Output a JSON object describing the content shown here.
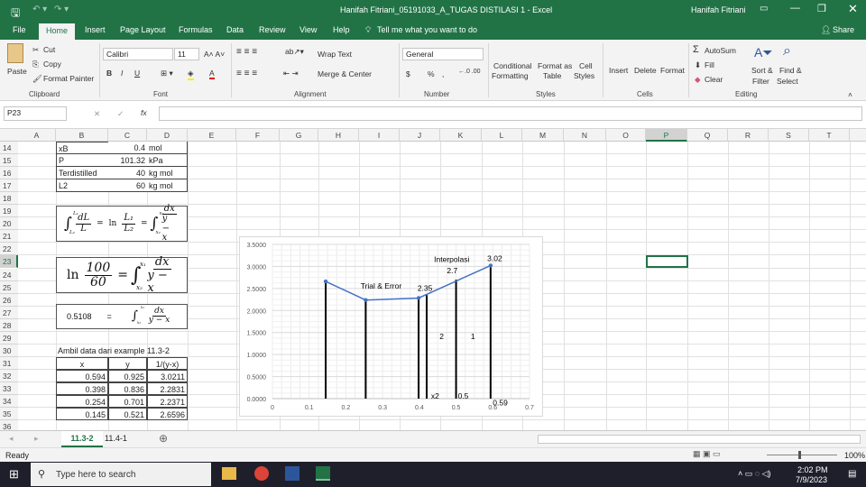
{
  "title": {
    "filename": "Hanifah Fitriani_05191033_A_TUGAS DISTILASI 1  -  Excel",
    "user": "Hanifah Fitriani"
  },
  "menu": {
    "tabs": [
      "File",
      "Home",
      "Insert",
      "Page Layout",
      "Formulas",
      "Data",
      "Review",
      "View",
      "Help"
    ],
    "tell_me": "Tell me what you want to do",
    "share": "Share"
  },
  "ribbon": {
    "clipboard": {
      "paste": "Paste",
      "cut": "Cut",
      "copy": "Copy",
      "format_painter": "Format Painter",
      "label": "Clipboard"
    },
    "font": {
      "name": "Calibri",
      "size": "11",
      "label": "Font",
      "bold": "B",
      "italic": "I",
      "underline": "U"
    },
    "alignment": {
      "wrap": "Wrap Text",
      "merge": "Merge & Center",
      "label": "Alignment"
    },
    "number": {
      "format": "General",
      "currency": "$",
      "percent": "%",
      "comma": ",",
      "label": "Number"
    },
    "styles": {
      "conditional": "Conditional",
      "conditional2": "Formatting",
      "format_table": "Format as",
      "format_table2": "Table",
      "cell_styles": "Cell",
      "cell_styles2": "Styles",
      "label": "Styles"
    },
    "cells": {
      "insert": "Insert",
      "delete": "Delete",
      "format": "Format",
      "label": "Cells"
    },
    "editing": {
      "autosum": "AutoSum",
      "fill": "Fill",
      "clear": "Clear",
      "sort": "Sort &",
      "sort2": "Filter",
      "find": "Find &",
      "find2": "Select",
      "label": "Editing"
    }
  },
  "formula_bar": {
    "name_box": "P23",
    "fx": "fx",
    "value": ""
  },
  "columns": [
    "A",
    "B",
    "C",
    "D",
    "E",
    "F",
    "G",
    "H",
    "I",
    "J",
    "K",
    "L",
    "M",
    "N",
    "O",
    "P",
    "Q",
    "R",
    "S",
    "T"
  ],
  "rows": [
    "14",
    "15",
    "16",
    "17",
    "18",
    "19",
    "20",
    "21",
    "22",
    "23",
    "24",
    "25",
    "26",
    "27",
    "28",
    "29",
    "30",
    "31",
    "32",
    "33",
    "34",
    "35",
    "36"
  ],
  "selected_cell": "P23",
  "params": [
    [
      "xB",
      "0.4",
      "mol"
    ],
    [
      "P",
      "101.32",
      "kPa"
    ],
    [
      "Terdistilled",
      "40",
      "kg mol"
    ],
    [
      "L2",
      "60",
      "kg mol"
    ]
  ],
  "equations": {
    "eq1": {
      "int_lower": "L₂",
      "int_upper": "L₁",
      "frac1_num": "dL",
      "frac1_den": "L",
      "ln": "ln",
      "frac2_num": "L₁",
      "frac2_den": "L₂",
      "int2_lower": "x₂",
      "int2_upper": "x₁",
      "frac3_num": "dx",
      "frac3_den": "y − x",
      "eq": "="
    },
    "eq2": {
      "ln": "ln",
      "num": "100",
      "den": "60",
      "eq": "=",
      "int_lower": "x₂",
      "int_upper": "x₁",
      "frac_num": "dx",
      "frac_den": "y − x"
    },
    "eq3": {
      "value": "0.5108",
      "eq": "=",
      "int_lower": "x₂",
      "int_upper": "x₁",
      "frac_num": "dx",
      "frac_den": "y − x"
    }
  },
  "data_table": {
    "caption": "Ambil data dari example 11.3-2",
    "headers": [
      "x",
      "y",
      "1/(y-x)"
    ],
    "rows": [
      [
        "0.594",
        "0.925",
        "3.0211"
      ],
      [
        "0.398",
        "0.836",
        "2.2831"
      ],
      [
        "0.254",
        "0.701",
        "2.2371"
      ],
      [
        "0.145",
        "0.521",
        "2.6596"
      ]
    ]
  },
  "chart_data": {
    "type": "line",
    "x": [
      0.145,
      0.254,
      0.398,
      0.594
    ],
    "y": [
      2.6596,
      2.2371,
      2.2831,
      3.0211
    ],
    "series_color": "#4472c4",
    "xlim": [
      0,
      0.7
    ],
    "ylim": [
      0,
      3.5
    ],
    "x_ticks": [
      "0",
      "0.1",
      "0.2",
      "0.3",
      "0.4",
      "0.5",
      "0.6",
      "0.7"
    ],
    "y_ticks": [
      "0.0000",
      "0.5000",
      "1.0000",
      "1.5000",
      "2.0000",
      "2.5000",
      "3.0000",
      "3.5000"
    ],
    "grid": true,
    "vertical_lines": [
      {
        "x": 0.145,
        "y": 2.6596
      },
      {
        "x": 0.254,
        "y": 2.2371
      },
      {
        "x": 0.398,
        "y": 2.2831
      },
      {
        "x": 0.42,
        "y": 2.35
      },
      {
        "x": 0.5,
        "y": 2.7
      },
      {
        "x": 0.594,
        "y": 3.0211
      }
    ],
    "annotations": [
      {
        "text": "Trial & Error",
        "x": 0.24,
        "y": 2.5
      },
      {
        "text": "2.35",
        "x": 0.395,
        "y": 2.45
      },
      {
        "text": "Interpolasi",
        "x": 0.44,
        "y": 3.1
      },
      {
        "text": "2.7",
        "x": 0.475,
        "y": 2.85
      },
      {
        "text": "3.02",
        "x": 0.585,
        "y": 3.12
      },
      {
        "text": "2",
        "x": 0.455,
        "y": 1.35
      },
      {
        "text": "1",
        "x": 0.54,
        "y": 1.35
      },
      {
        "text": "x2",
        "x": 0.432,
        "y": 0.0
      },
      {
        "text": "0.5",
        "x": 0.505,
        "y": 0.0
      },
      {
        "text": "0.59",
        "x": 0.6,
        "y": -0.15
      }
    ]
  },
  "sheets": [
    "11.3-2",
    "11.4-1"
  ],
  "active_sheet": "11.3-2",
  "status": {
    "ready": "Ready",
    "zoom": "100%"
  },
  "taskbar": {
    "search": "Type here to search",
    "time": "2:02 PM",
    "date": "7/9/2023"
  }
}
